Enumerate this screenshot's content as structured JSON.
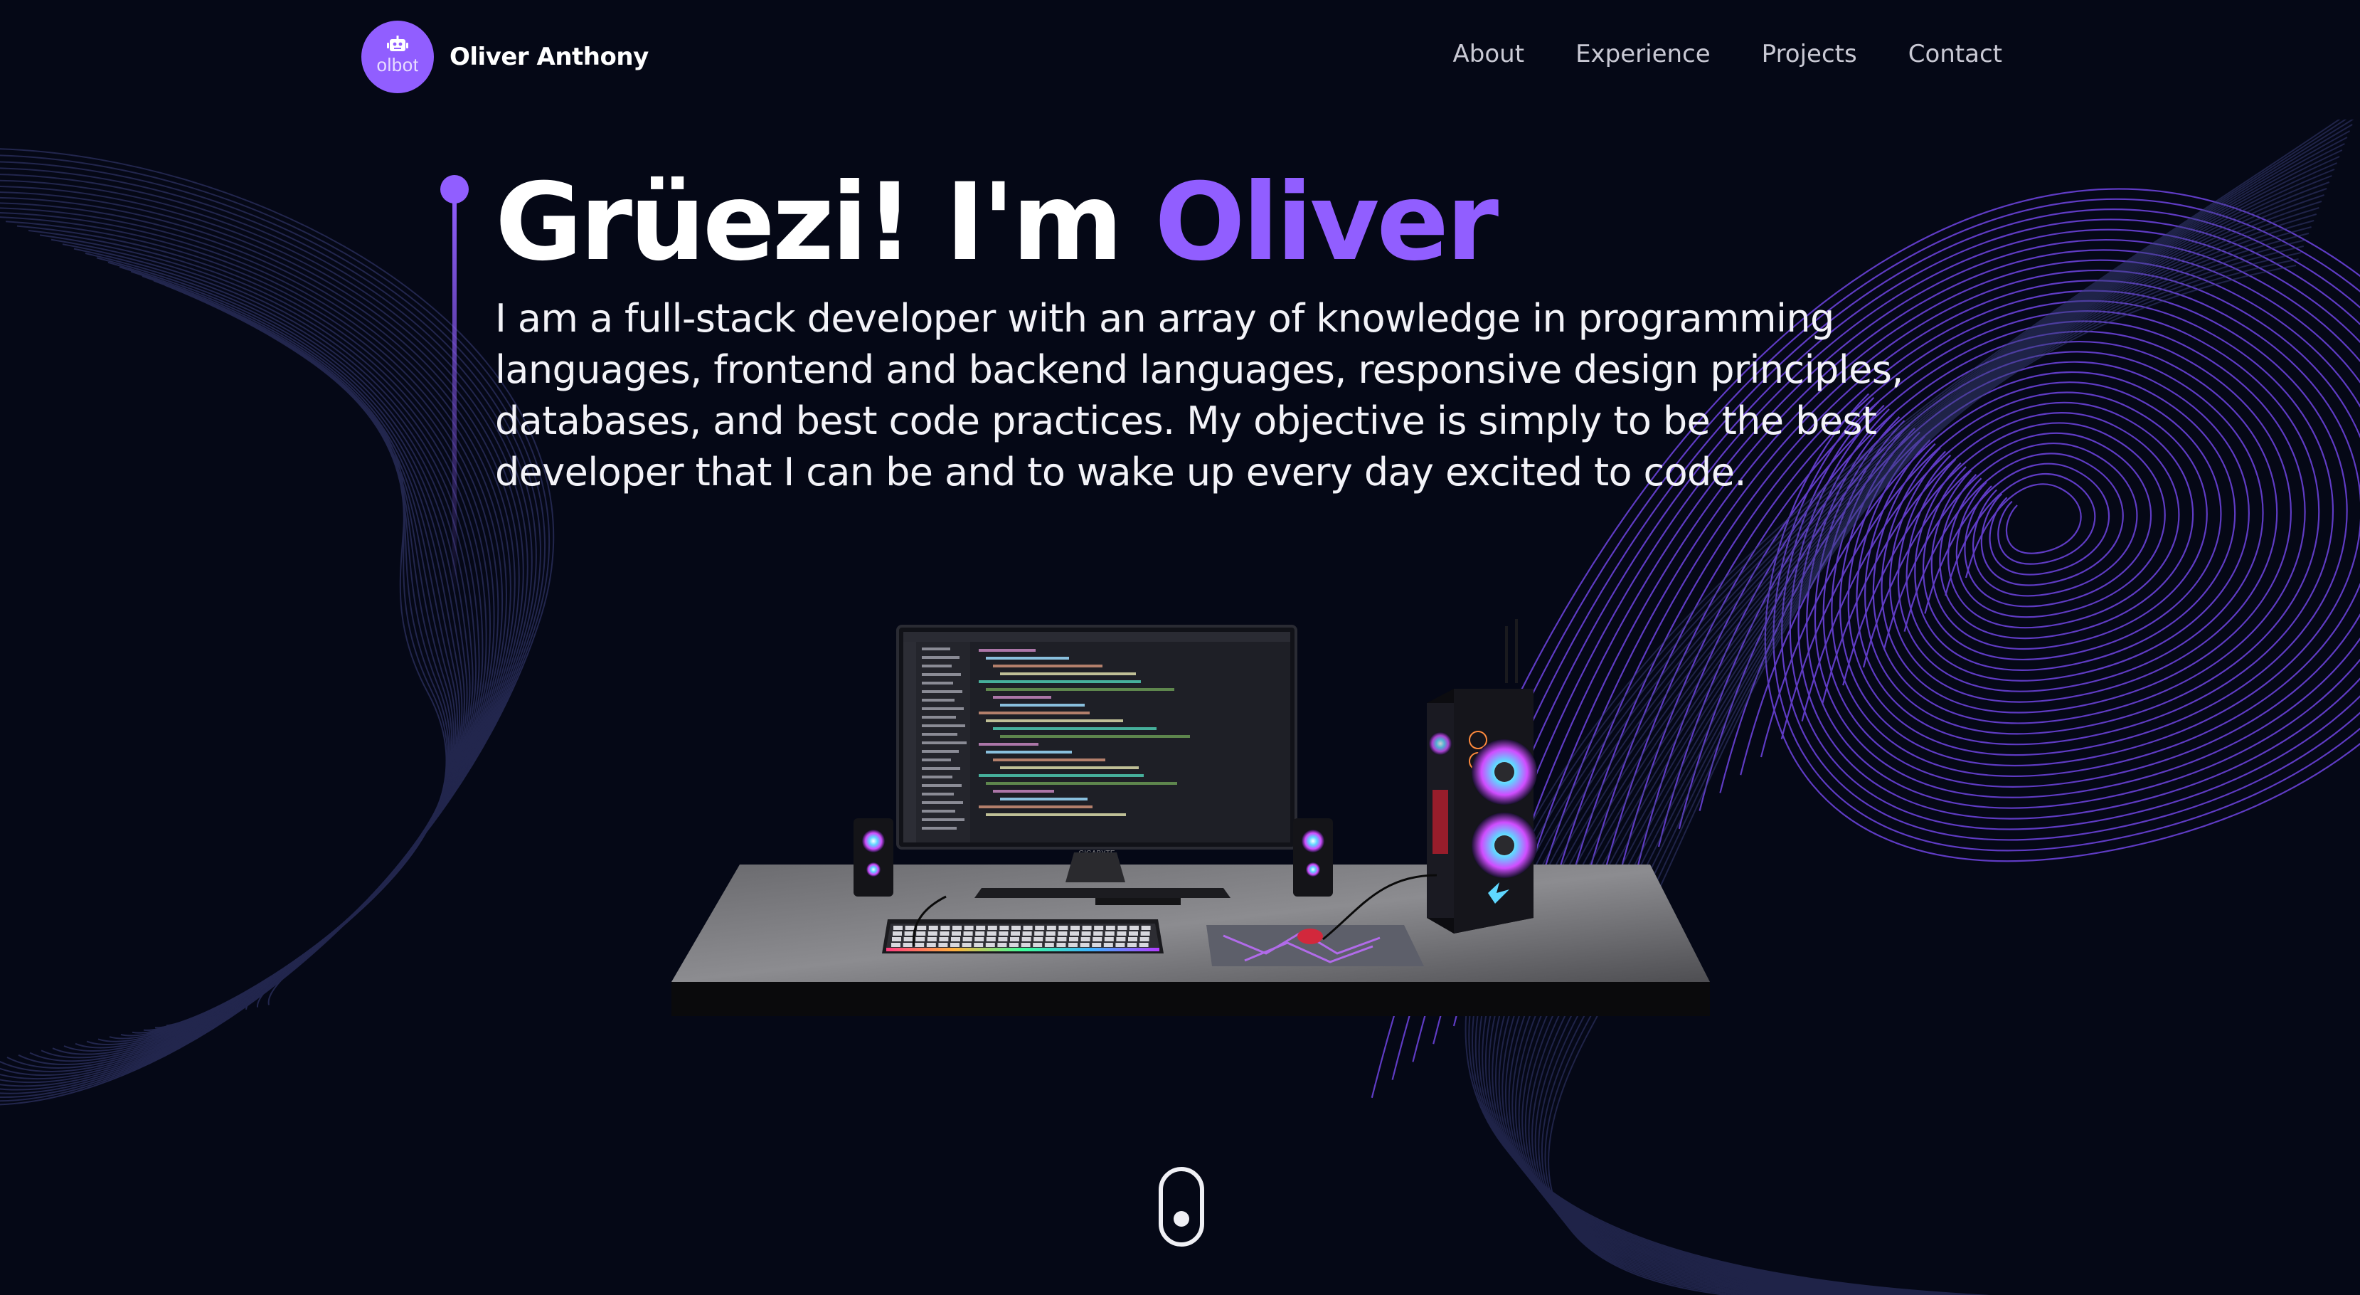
{
  "brand": {
    "logo_text": "olbot",
    "name": "Oliver Anthony"
  },
  "nav": {
    "links": [
      "About",
      "Experience",
      "Projects",
      "Contact"
    ]
  },
  "hero": {
    "greeting": "Grüezi! I'm ",
    "name": "Oliver",
    "description": "I am a full-stack developer with an array of knowledge in programming languages, frontend and backend languages, responsive design principles, databases, and best code practices. My objective is simply to be the best developer that I can be and to wake up every day excited to code."
  },
  "scene": {
    "monitor_brand": "GIGABYTE"
  },
  "colors": {
    "background": "#050816",
    "accent": "#915eff",
    "text": "#ffffff",
    "nav_text": "#c9c9d4"
  },
  "icons": {
    "logo": "robot-icon",
    "scroll": "mouse-scroll-icon"
  }
}
